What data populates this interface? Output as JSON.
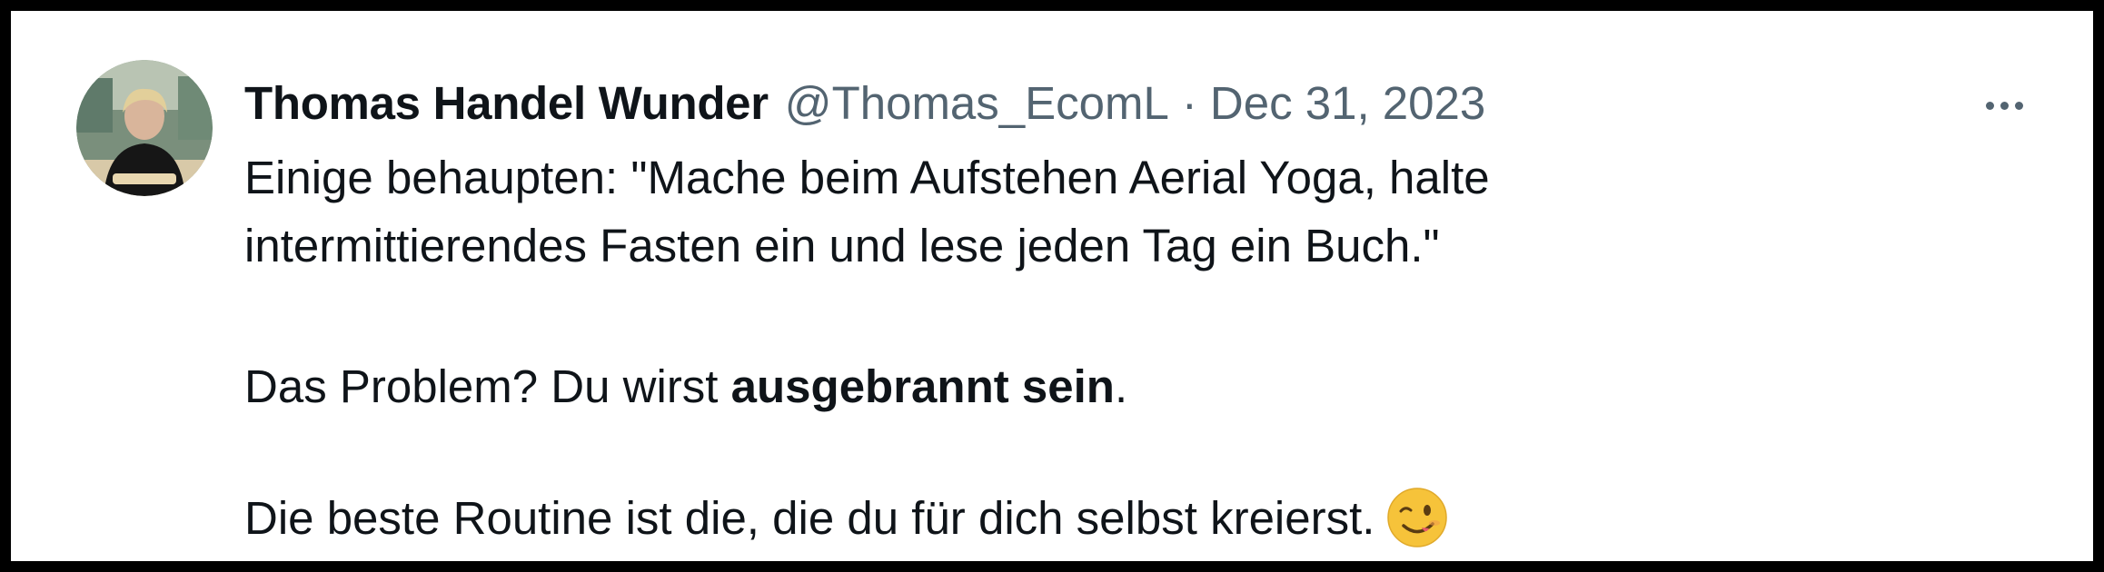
{
  "tweet": {
    "display_name": "Thomas Handel Wunder",
    "handle": "@Thomas_EcomL",
    "separator": "·",
    "date": "Dec 31, 2023",
    "more_icon": "more-horizontal-icon",
    "lines": {
      "l1": "Einige behaupten: \"Mache beim Aufstehen Aerial Yoga, halte",
      "l2": "intermittierendes Fasten ein und lese jeden Tag ein Buch.\"",
      "l3_prefix": "Das Problem? Du wirst ",
      "l3_bold": "ausgebrannt sein",
      "l3_suffix": ".",
      "l4": "Die beste Routine ist die, die du für dich selbst kreierst."
    },
    "emoji": "winking-face-emoji"
  },
  "colors": {
    "text_primary": "#0f1419",
    "text_secondary": "#536471",
    "border": "#000000",
    "background": "#ffffff",
    "emoji_yellow": "#f6c33a"
  }
}
